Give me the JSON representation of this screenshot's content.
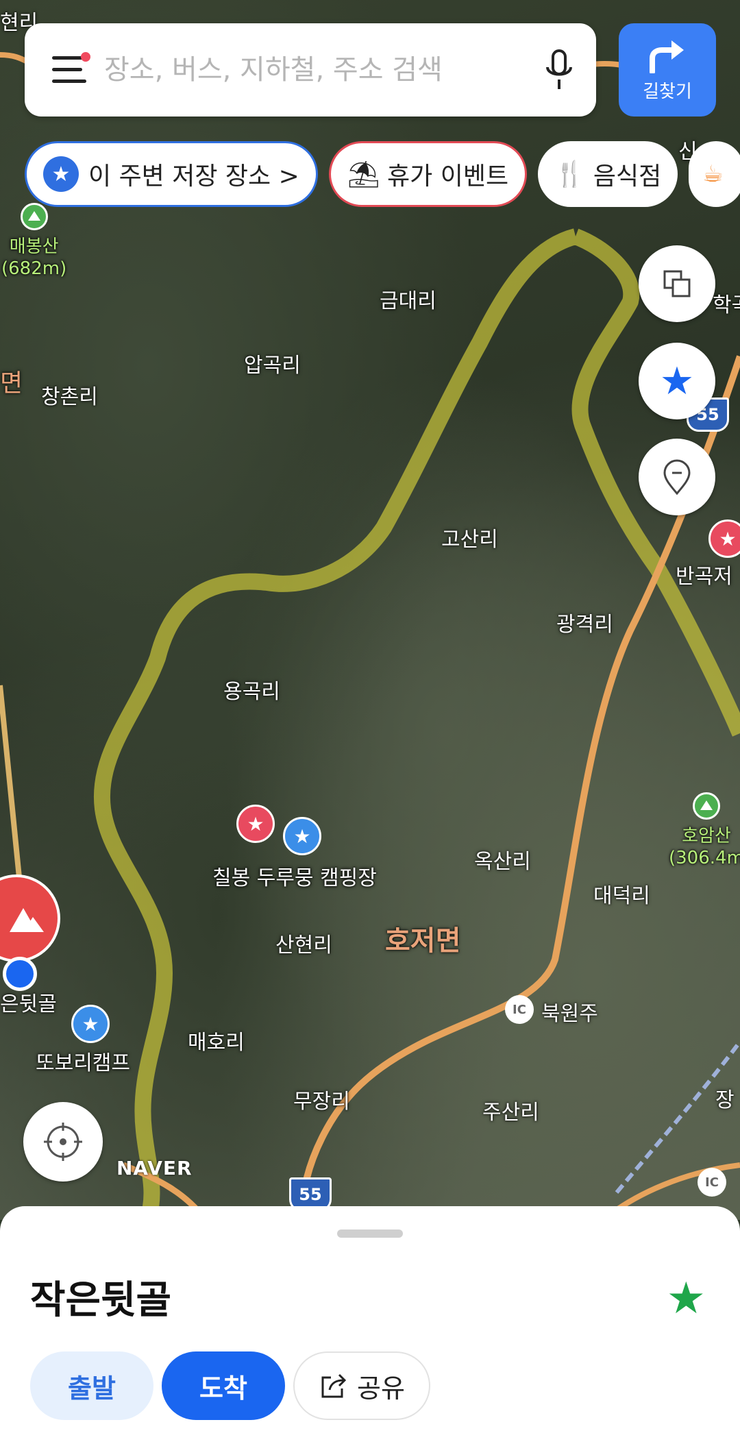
{
  "search": {
    "placeholder": "장소, 버스, 지하철, 주소 검색"
  },
  "directions_button": {
    "label": "길찾기"
  },
  "chips": [
    {
      "label": "이 주변 저장 장소 >"
    },
    {
      "label": "휴가 이벤트"
    },
    {
      "label": "음식점"
    }
  ],
  "map": {
    "places": [
      {
        "label": "현리"
      },
      {
        "label": "금대리"
      },
      {
        "label": "압곡리"
      },
      {
        "label": "창촌리"
      },
      {
        "label": "면"
      },
      {
        "label": "고산리"
      },
      {
        "label": "광격리"
      },
      {
        "label": "용곡리"
      },
      {
        "label": "옥산리"
      },
      {
        "label": "대덕리"
      },
      {
        "label": "산현리"
      },
      {
        "label": "호저면"
      },
      {
        "label": "매호리"
      },
      {
        "label": "무장리"
      },
      {
        "label": "주산리"
      },
      {
        "label": "반곡저"
      },
      {
        "label": "북원주"
      },
      {
        "label": "은뒷골"
      },
      {
        "label": "학곡"
      },
      {
        "label": "신"
      },
      {
        "label": "장"
      }
    ],
    "mountains": [
      {
        "name": "매봉산",
        "elev": "(682m)"
      },
      {
        "name": "호암산",
        "elev": "(306.4m"
      }
    ],
    "pois": [
      {
        "label": "칠봉 두루뭉 캠핑장"
      },
      {
        "label": "또보리캠프"
      }
    ],
    "highway": "55",
    "ic": "IC",
    "brand": "NAVER"
  },
  "place": {
    "name": "작은뒷골",
    "depart": "출발",
    "arrive": "도착",
    "share": "공유"
  },
  "colors": {
    "accent": "#1a66f0",
    "favorite": "#1fa64a",
    "boundary": "#c9c43a"
  }
}
